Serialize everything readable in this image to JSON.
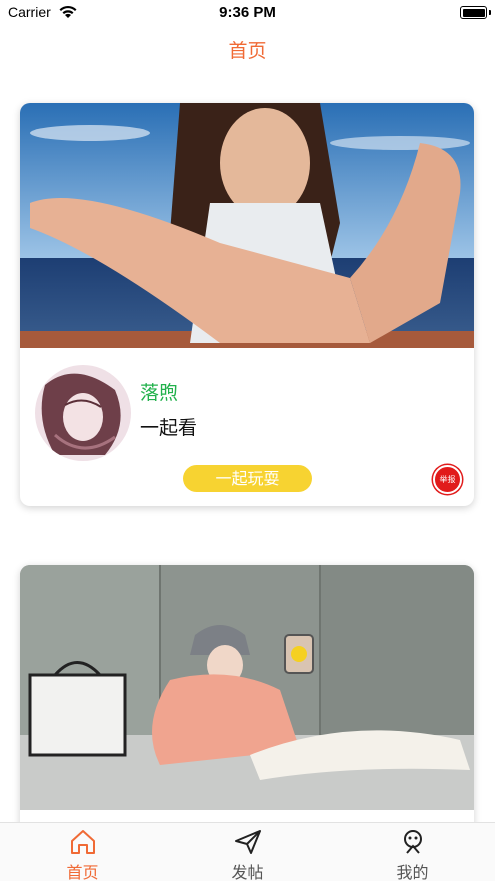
{
  "status_bar": {
    "carrier": "Carrier",
    "time": "9:36 PM",
    "battery_level": 1.0
  },
  "nav": {
    "title": "首页"
  },
  "feed": {
    "posts": [
      {
        "photo_icon": "photo-woman-hand",
        "avatar_icon": "avatar-sketch",
        "username": "落煦",
        "caption": "一起看",
        "action_label": "一起玩耍",
        "report_label": "举报"
      },
      {
        "photo_icon": "photo-woman-sweater"
      }
    ]
  },
  "tab_bar": {
    "items": [
      {
        "label": "首页",
        "icon": "home-icon",
        "active": true
      },
      {
        "label": "发帖",
        "icon": "send-icon",
        "active": false
      },
      {
        "label": "我的",
        "icon": "profile-icon",
        "active": false
      }
    ]
  },
  "colors": {
    "accent": "#f06a35",
    "username": "#22b14c",
    "action_button": "#f7d331",
    "report_badge": "#e11b1b"
  }
}
